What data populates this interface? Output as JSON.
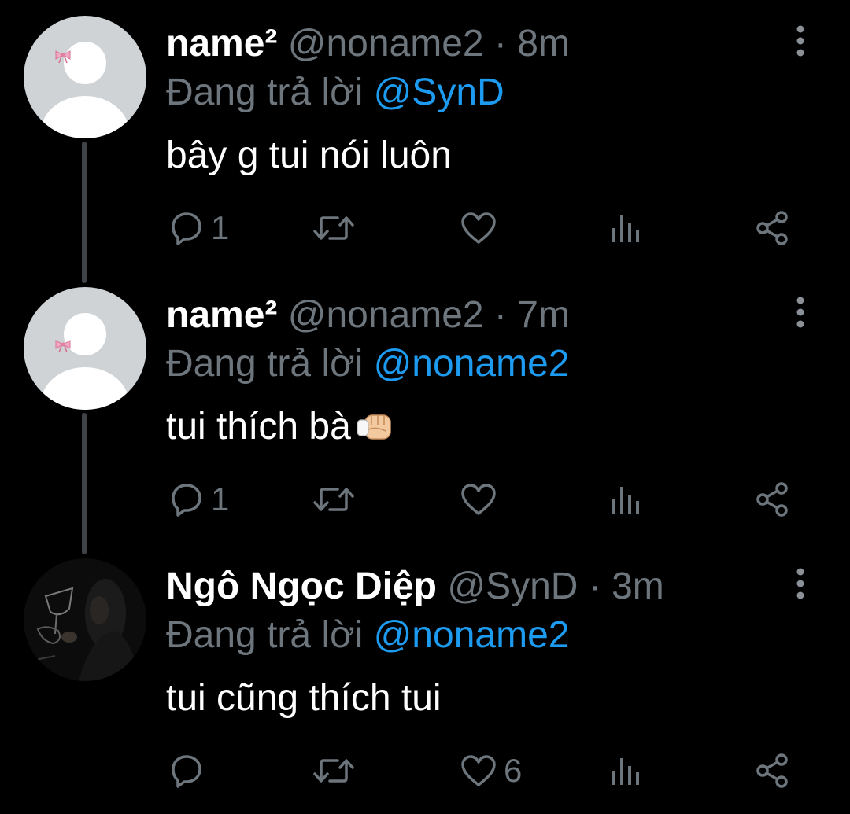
{
  "colors": {
    "background": "#000000",
    "muted": "#6e767d",
    "link": "#1d9bf0",
    "text": "#ffffff",
    "thread_line": "#3f4348"
  },
  "tweets": [
    {
      "display_name": "name²",
      "handle_time": " @noname2 · 8m",
      "reply_prefix": "Đang trả lời ",
      "reply_target": "@SynD",
      "body": "bây g tui nói luôn",
      "avatar": "default-avatar-with-bow-icon",
      "reply_count": "1",
      "retweet_count": "",
      "like_count": "",
      "liked": false
    },
    {
      "display_name": "name²",
      "handle_time": " @noname2 · 7m",
      "reply_prefix": "Đang trả lời ",
      "reply_target": "@noname2",
      "body": "tui thích bà",
      "body_emoji": "fist-bump-emoji",
      "avatar": "default-avatar-with-bow-icon",
      "reply_count": "1",
      "retweet_count": "",
      "like_count": "",
      "liked": false
    },
    {
      "display_name": "Ngô Ngọc Diệp",
      "handle_time": " @SynD · 3m",
      "reply_prefix": "Đang trả lời ",
      "reply_target": "@noname2",
      "body": "tui cũng thích tui",
      "avatar": "photo-avatar",
      "reply_count": "",
      "retweet_count": "",
      "like_count": "6",
      "liked": false
    }
  ],
  "icons": {
    "reply": "reply-icon",
    "retweet": "retweet-icon",
    "like": "heart-icon",
    "views": "views-icon",
    "share": "share-icon",
    "more": "more-vertical-icon"
  }
}
